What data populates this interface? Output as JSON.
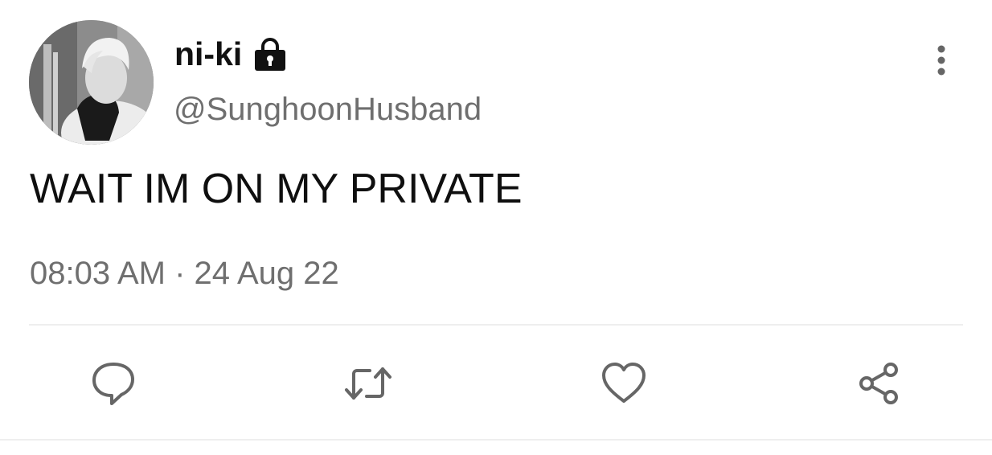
{
  "tweet": {
    "display_name": "ni-ki",
    "handle": "@SunghoonHusband",
    "text": "WAIT IM ON MY PRIVATE",
    "timestamp": "08:03 AM · 24 Aug 22",
    "account_protected": true
  },
  "icons": {
    "lock": "lock-icon",
    "more": "more-vertical-icon",
    "reply": "reply-bubble-icon",
    "retweet": "retweet-icon",
    "like": "heart-icon",
    "share": "share-icon"
  },
  "colors": {
    "primary_text": "#0f0f0f",
    "secondary_text": "#6f6f6f",
    "icon": "#666666",
    "divider": "#eeeeee",
    "background": "#ffffff"
  }
}
